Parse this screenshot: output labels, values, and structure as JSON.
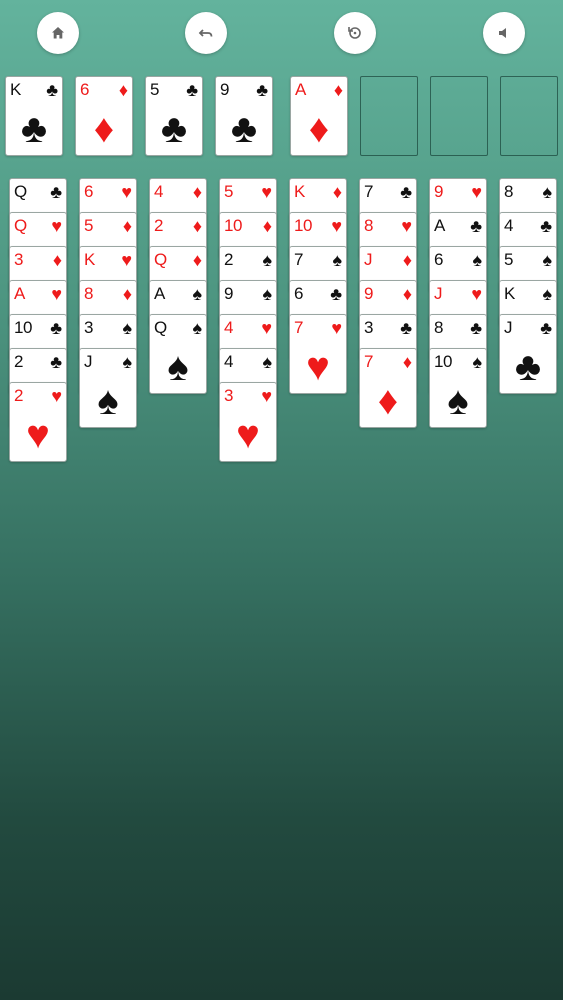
{
  "toolbar": {
    "buttons": [
      {
        "name": "home-button",
        "icon": "home-icon"
      },
      {
        "name": "undo-button",
        "icon": "undo-icon"
      },
      {
        "name": "restart-button",
        "icon": "restart-icon"
      },
      {
        "name": "sound-button",
        "icon": "speaker-icon"
      }
    ]
  },
  "colors": {
    "red": "#ee1b1b",
    "black": "#111111",
    "felt_top": "#63b39d",
    "felt_bottom": "#1b3a32"
  },
  "freecells": [
    {
      "rank": "K",
      "suit": "♣",
      "color": "black"
    },
    {
      "rank": "6",
      "suit": "♦",
      "color": "red"
    },
    {
      "rank": "5",
      "suit": "♣",
      "color": "black"
    },
    {
      "rank": "9",
      "suit": "♣",
      "color": "black"
    }
  ],
  "foundations": [
    {
      "rank": "A",
      "suit": "♦",
      "color": "red"
    },
    null,
    null,
    null
  ],
  "tableau": [
    [
      {
        "rank": "Q",
        "suit": "♣",
        "color": "black"
      },
      {
        "rank": "Q",
        "suit": "♥",
        "color": "red"
      },
      {
        "rank": "3",
        "suit": "♦",
        "color": "red"
      },
      {
        "rank": "A",
        "suit": "♥",
        "color": "red"
      },
      {
        "rank": "10",
        "suit": "♣",
        "color": "black"
      },
      {
        "rank": "2",
        "suit": "♣",
        "color": "black"
      },
      {
        "rank": "2",
        "suit": "♥",
        "color": "red"
      }
    ],
    [
      {
        "rank": "6",
        "suit": "♥",
        "color": "red"
      },
      {
        "rank": "5",
        "suit": "♦",
        "color": "red"
      },
      {
        "rank": "K",
        "suit": "♥",
        "color": "red"
      },
      {
        "rank": "8",
        "suit": "♦",
        "color": "red"
      },
      {
        "rank": "3",
        "suit": "♠",
        "color": "black"
      },
      {
        "rank": "J",
        "suit": "♠",
        "color": "black"
      }
    ],
    [
      {
        "rank": "4",
        "suit": "♦",
        "color": "red"
      },
      {
        "rank": "2",
        "suit": "♦",
        "color": "red"
      },
      {
        "rank": "Q",
        "suit": "♦",
        "color": "red"
      },
      {
        "rank": "A",
        "suit": "♠",
        "color": "black"
      },
      {
        "rank": "Q",
        "suit": "♠",
        "color": "black"
      }
    ],
    [
      {
        "rank": "5",
        "suit": "♥",
        "color": "red"
      },
      {
        "rank": "10",
        "suit": "♦",
        "color": "red"
      },
      {
        "rank": "2",
        "suit": "♠",
        "color": "black"
      },
      {
        "rank": "9",
        "suit": "♠",
        "color": "black"
      },
      {
        "rank": "4",
        "suit": "♥",
        "color": "red"
      },
      {
        "rank": "4",
        "suit": "♠",
        "color": "black"
      },
      {
        "rank": "3",
        "suit": "♥",
        "color": "red"
      }
    ],
    [
      {
        "rank": "K",
        "suit": "♦",
        "color": "red"
      },
      {
        "rank": "10",
        "suit": "♥",
        "color": "red"
      },
      {
        "rank": "7",
        "suit": "♠",
        "color": "black"
      },
      {
        "rank": "6",
        "suit": "♣",
        "color": "black"
      },
      {
        "rank": "7",
        "suit": "♥",
        "color": "red"
      }
    ],
    [
      {
        "rank": "7",
        "suit": "♣",
        "color": "black"
      },
      {
        "rank": "8",
        "suit": "♥",
        "color": "red"
      },
      {
        "rank": "J",
        "suit": "♦",
        "color": "red"
      },
      {
        "rank": "9",
        "suit": "♦",
        "color": "red"
      },
      {
        "rank": "3",
        "suit": "♣",
        "color": "black"
      },
      {
        "rank": "7",
        "suit": "♦",
        "color": "red"
      }
    ],
    [
      {
        "rank": "9",
        "suit": "♥",
        "color": "red"
      },
      {
        "rank": "A",
        "suit": "♣",
        "color": "black"
      },
      {
        "rank": "6",
        "suit": "♠",
        "color": "black"
      },
      {
        "rank": "J",
        "suit": "♥",
        "color": "red"
      },
      {
        "rank": "8",
        "suit": "♣",
        "color": "black"
      },
      {
        "rank": "10",
        "suit": "♠",
        "color": "black"
      }
    ],
    [
      {
        "rank": "8",
        "suit": "♠",
        "color": "black"
      },
      {
        "rank": "4",
        "suit": "♣",
        "color": "black"
      },
      {
        "rank": "5",
        "suit": "♠",
        "color": "black"
      },
      {
        "rank": "K",
        "suit": "♠",
        "color": "black"
      },
      {
        "rank": "J",
        "suit": "♣",
        "color": "black"
      }
    ]
  ]
}
